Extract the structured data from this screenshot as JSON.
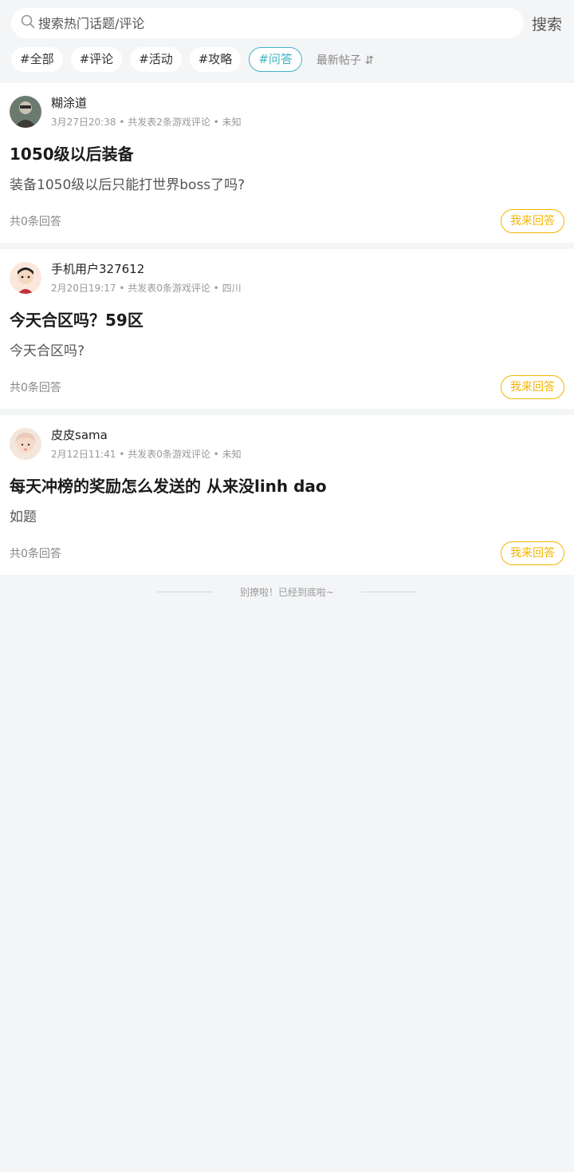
{
  "search": {
    "placeholder": "搜索热门话题/评论",
    "button_label": "搜索"
  },
  "tags": [
    {
      "label": "#全部",
      "active": false
    },
    {
      "label": "#评论",
      "active": false
    },
    {
      "label": "#活动",
      "active": false
    },
    {
      "label": "#攻略",
      "active": false
    },
    {
      "label": "#问答",
      "active": true
    }
  ],
  "sort": {
    "label": "最新帖子",
    "icon": "sort-arrows-icon"
  },
  "posts": [
    {
      "author": "糊涂道",
      "date": "3月27日20:38",
      "comment_count": "共发表2条游戏评论",
      "location": "未知",
      "title": "1050级以后装备",
      "body": "装备1050级以后只能打世界boss了吗?",
      "answers": "共0条回答",
      "answer_button": "我来回答"
    },
    {
      "author": "手机用户327612",
      "date": "2月20日19:17",
      "comment_count": "共发表0条游戏评论",
      "location": "四川",
      "title": "今天合区吗？59区",
      "body": "今天合区吗?",
      "answers": "共0条回答",
      "answer_button": "我来回答"
    },
    {
      "author": "皮皮sama",
      "date": "2月12日11:41",
      "comment_count": "共发表0条游戏评论",
      "location": "未知",
      "title": "每天冲榜的奖励怎么发送的 从来没linh dao",
      "body": "如题",
      "answers": "共0条回答",
      "answer_button": "我来回答"
    }
  ],
  "footer": {
    "end_text": "别撩啦！已经到底啦~"
  },
  "colors": {
    "accent": "#3fb3c6",
    "answer": "#f5b400",
    "background": "#f4f5f7"
  }
}
